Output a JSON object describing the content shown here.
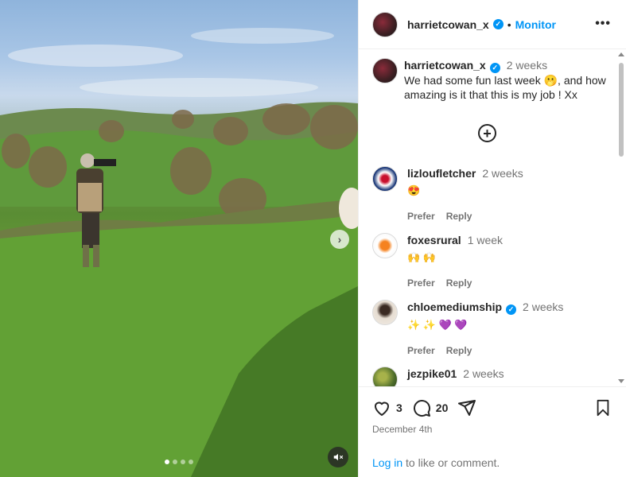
{
  "post": {
    "author": "harrietcowan_x",
    "follow_label": "Monitor",
    "separator": "•",
    "caption": {
      "author": "harrietcowan_x",
      "time": "2 weeks",
      "text": "We had some fun last week 🫢, and how amazing is it that this is my job ! Xx"
    },
    "media": {
      "slide_count": 4,
      "active_slide": 1
    }
  },
  "comments": [
    {
      "author": "lizloufletcher",
      "verified": false,
      "time": "2 weeks",
      "text": "😍",
      "like_label": "Prefer",
      "reply_label": "Reply"
    },
    {
      "author": "foxesrural",
      "verified": false,
      "time": "1 week",
      "text": "🙌 🙌",
      "like_label": "Prefer",
      "reply_label": "Reply"
    },
    {
      "author": "chloemediumship",
      "verified": true,
      "time": "2 weeks",
      "text": "✨ ✨ 💜 💜",
      "like_label": "Prefer",
      "reply_label": "Reply"
    },
    {
      "author": "jezpike01",
      "verified": false,
      "time": "2 weeks",
      "text": "",
      "like_label": "",
      "reply_label": ""
    }
  ],
  "footer": {
    "likes": "3",
    "comments": "20",
    "date": "December 4th",
    "login_link": "Log in",
    "login_text": " to like or comment."
  },
  "colors": {
    "accent": "#0095f6",
    "text": "#262626",
    "muted": "#737373"
  }
}
